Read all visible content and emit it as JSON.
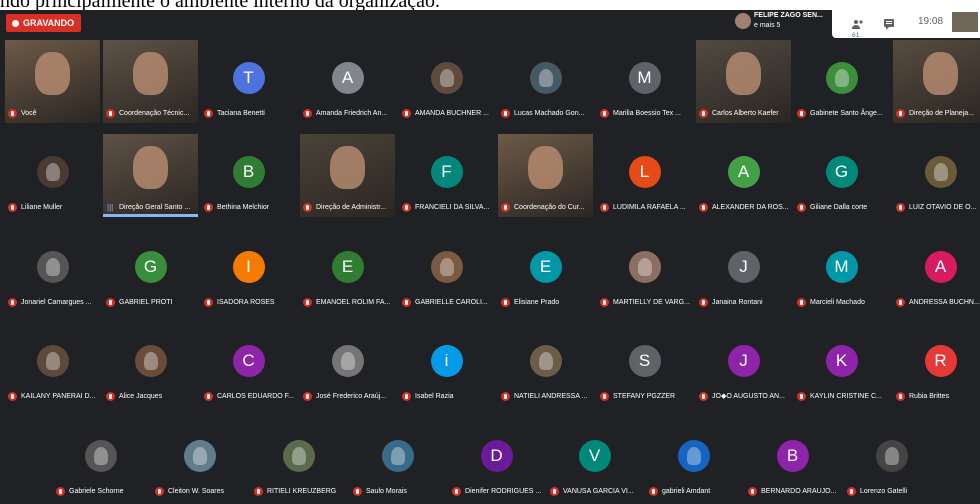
{
  "caption": "ndo principalmente o ambiente interno da organização.",
  "topbar": {
    "recording_label": "GRAVANDO",
    "speaker_name": "FELIPE ZAGO SEN...",
    "speaker_more": "e mais 5",
    "people_count": "61",
    "time": "19:08"
  },
  "colors": {
    "background": "#202124",
    "recording": "#d93025",
    "mic_off": "#d93025",
    "speaking": "#8ab4f8"
  },
  "rows": [
    [
      {
        "name": "Você",
        "letter": "",
        "color": "",
        "video": true
      },
      {
        "name": "Coordenação Técnic...",
        "letter": "",
        "color": "",
        "video": true
      },
      {
        "name": "Taciana Benetti",
        "letter": "T",
        "color": "#4e73df",
        "video": false
      },
      {
        "name": "Amanda Friedrich An...",
        "letter": "A",
        "color": "#80868b",
        "video": false
      },
      {
        "name": "AMANDA BUCHNER ...",
        "letter": "",
        "color": "#5f4b3c",
        "video": false
      },
      {
        "name": "Lucas Machado Gon...",
        "letter": "",
        "color": "#455a64",
        "video": false
      },
      {
        "name": "Marilia Boessio Tex ...",
        "letter": "M",
        "color": "#5f6368",
        "video": false
      },
      {
        "name": "Carlos Alberto Kaefer",
        "letter": "",
        "color": "",
        "video": true
      },
      {
        "name": "Gabinete Santo Ânge...",
        "letter": "",
        "color": "#3c8d3c",
        "video": false
      },
      {
        "name": "Direção de Planeja...",
        "letter": "",
        "color": "",
        "video": true
      }
    ],
    [
      {
        "name": "Liliane Muller",
        "letter": "",
        "color": "#4a3a32",
        "video": false
      },
      {
        "name": "Direção Geral Santo ...",
        "letter": "",
        "color": "",
        "video": true,
        "speaking": true
      },
      {
        "name": "Bethina Melchior",
        "letter": "B",
        "color": "#2e7d32",
        "video": false
      },
      {
        "name": "Direção de Administr...",
        "letter": "",
        "color": "",
        "video": true
      },
      {
        "name": "FRANCIELI DA SILVA...",
        "letter": "F",
        "color": "#00897b",
        "video": false
      },
      {
        "name": "Coordenação do Cur...",
        "letter": "",
        "color": "",
        "video": true
      },
      {
        "name": "LUDIMILA RAFAELA ...",
        "letter": "L",
        "color": "#e64a19",
        "video": false
      },
      {
        "name": "ALEXANDER DA ROS...",
        "letter": "A",
        "color": "#43a047",
        "video": false
      },
      {
        "name": "Giliane Dalla corte",
        "letter": "G",
        "color": "#00897b",
        "video": false
      },
      {
        "name": "LUIZ OTAVIO DE O...",
        "letter": "",
        "color": "#6b5a3a",
        "video": false
      }
    ],
    [
      {
        "name": "Jonariel Camargues ...",
        "letter": "",
        "color": "#555",
        "video": false
      },
      {
        "name": "GABRIEL PROTI",
        "letter": "G",
        "color": "#388e3c",
        "video": false
      },
      {
        "name": "ISADORA ROSES",
        "letter": "I",
        "color": "#f57c00",
        "video": false
      },
      {
        "name": "EMANOEL ROLIM FA...",
        "letter": "E",
        "color": "#2e7d32",
        "video": false
      },
      {
        "name": "GABRIELLE CAROLI...",
        "letter": "",
        "color": "#7a5a40",
        "video": false
      },
      {
        "name": "Elisiane Prado",
        "letter": "E",
        "color": "#0097a7",
        "video": false
      },
      {
        "name": "MARTIELLY DE VARG...",
        "letter": "",
        "color": "#8d6e63",
        "video": false
      },
      {
        "name": "Janaina Rontani",
        "letter": "J",
        "color": "#5f6368",
        "video": false
      },
      {
        "name": "Marcieli Machado",
        "letter": "M",
        "color": "#0097a7",
        "video": false
      },
      {
        "name": "ANDRESSA BUCHN...",
        "letter": "A",
        "color": "#d81b60",
        "video": false
      }
    ],
    [
      {
        "name": "KAILANY PANERAI D...",
        "letter": "",
        "color": "#5d4a3a",
        "video": false
      },
      {
        "name": "Alice Jacques",
        "letter": "",
        "color": "#6b4c3b",
        "video": false
      },
      {
        "name": "CARLOS EDUARDO F...",
        "letter": "C",
        "color": "#8e24aa",
        "video": false
      },
      {
        "name": "José Frederico Araúj...",
        "letter": "",
        "color": "#757575",
        "video": false
      },
      {
        "name": "Isabel Razia",
        "letter": "i",
        "color": "#039be5",
        "video": false
      },
      {
        "name": "NATIELI ANDRESSA ...",
        "letter": "",
        "color": "#6d5c4a",
        "video": false
      },
      {
        "name": "STEFANY PGZZER",
        "letter": "S",
        "color": "#5f6368",
        "video": false
      },
      {
        "name": "JO◆O AUGUSTO AN...",
        "letter": "J",
        "color": "#8e24aa",
        "video": false
      },
      {
        "name": "KAYLIN CRISTINE C...",
        "letter": "K",
        "color": "#8e24aa",
        "video": false
      },
      {
        "name": "Rubia Brittes",
        "letter": "R",
        "color": "#e53935",
        "video": false
      }
    ]
  ],
  "bottom_row": [
    {
      "name": "Gabriele Schorne",
      "letter": "",
      "color": "#555"
    },
    {
      "name": "Cleiton W. Soares",
      "letter": "",
      "color": "#607d8b"
    },
    {
      "name": "RITIELI KREUZBERG",
      "letter": "",
      "color": "#5a6a4a"
    },
    {
      "name": "Saulo Morais",
      "letter": "",
      "color": "#3a6a8a"
    },
    {
      "name": "Dienifer RODRIGUES ...",
      "letter": "D",
      "color": "#6a1b9a"
    },
    {
      "name": "VANUSA GARCIA VI...",
      "letter": "V",
      "color": "#00897b"
    },
    {
      "name": "gabrieli Amdant",
      "letter": "",
      "color": "#1565c0"
    },
    {
      "name": "BERNARDO ARAUJO...",
      "letter": "B",
      "color": "#8e24aa"
    },
    {
      "name": "Lorenzo Gatelli",
      "letter": "",
      "color": "#444"
    }
  ]
}
